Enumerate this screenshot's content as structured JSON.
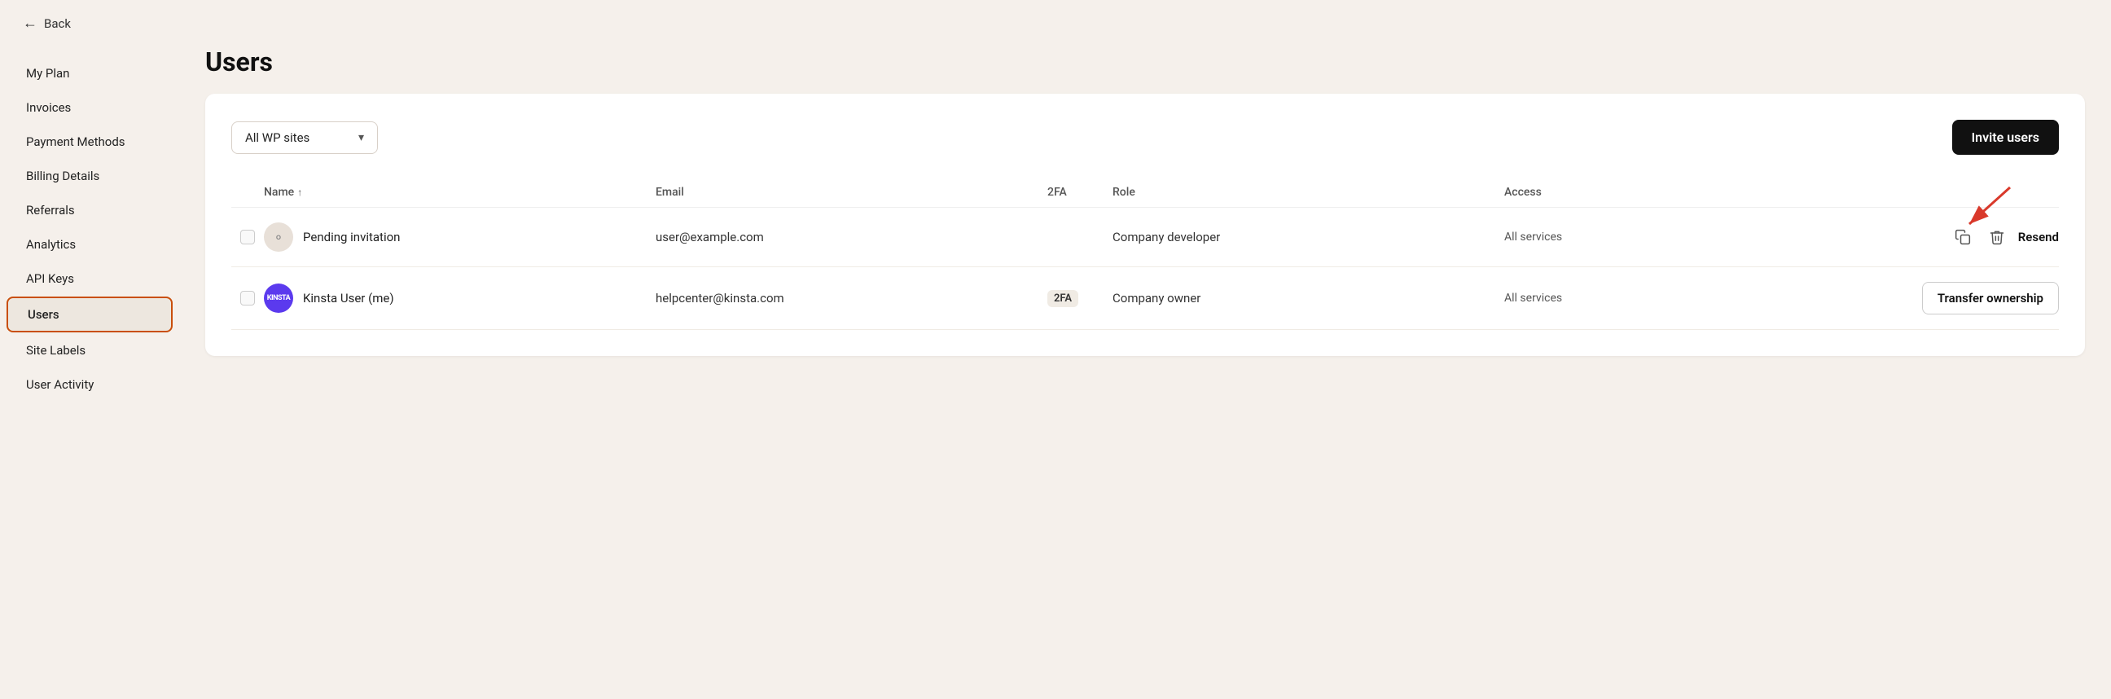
{
  "topbar": {
    "back_label": "Back"
  },
  "page": {
    "title": "Users"
  },
  "sidebar": {
    "items": [
      {
        "id": "my-plan",
        "label": "My Plan",
        "active": false
      },
      {
        "id": "invoices",
        "label": "Invoices",
        "active": false
      },
      {
        "id": "payment-methods",
        "label": "Payment Methods",
        "active": false
      },
      {
        "id": "billing-details",
        "label": "Billing Details",
        "active": false
      },
      {
        "id": "referrals",
        "label": "Referrals",
        "active": false
      },
      {
        "id": "analytics",
        "label": "Analytics",
        "active": false
      },
      {
        "id": "api-keys",
        "label": "API Keys",
        "active": false
      },
      {
        "id": "users",
        "label": "Users",
        "active": true
      },
      {
        "id": "site-labels",
        "label": "Site Labels",
        "active": false
      },
      {
        "id": "user-activity",
        "label": "User Activity",
        "active": false
      }
    ]
  },
  "toolbar": {
    "filter_label": "All WP sites",
    "invite_button_label": "Invite users"
  },
  "table": {
    "columns": {
      "name": "Name",
      "name_sort": "↑",
      "email": "Email",
      "twofa": "2FA",
      "role": "Role",
      "access": "Access"
    },
    "rows": [
      {
        "id": "row-pending",
        "avatar_type": "placeholder",
        "avatar_label": "person",
        "name": "Pending invitation",
        "email": "user@example.com",
        "twofa": "",
        "role": "Company developer",
        "access": "All services",
        "actions": [
          "copy",
          "delete",
          "resend"
        ],
        "resend_label": "Resend",
        "transfer_label": ""
      },
      {
        "id": "row-kinsta",
        "avatar_type": "kinsta",
        "avatar_label": "KINSTA",
        "name": "Kinsta User (me)",
        "email": "helpcenter@kinsta.com",
        "twofa": "2FA",
        "role": "Company owner",
        "access": "All services",
        "actions": [
          "transfer"
        ],
        "resend_label": "",
        "transfer_label": "Transfer ownership"
      }
    ]
  }
}
